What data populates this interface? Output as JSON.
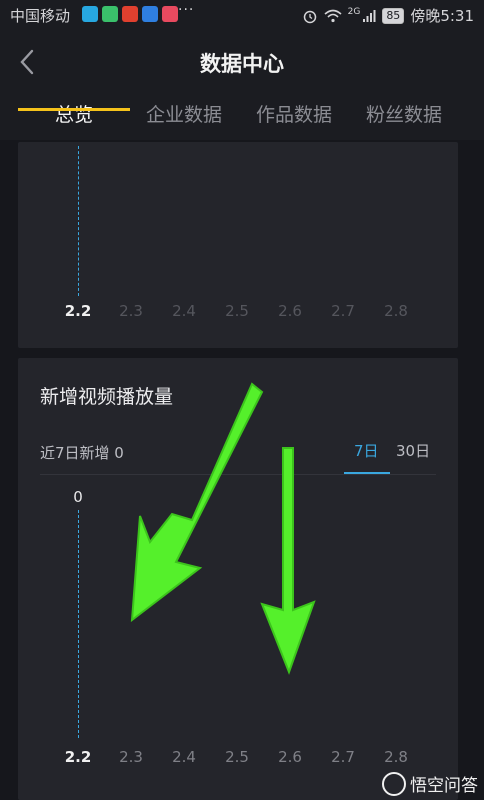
{
  "status_bar": {
    "carrier": "中国移动",
    "more": "···",
    "network": "2G",
    "battery": "85",
    "time": "傍晚5:31"
  },
  "header": {
    "title": "数据中心",
    "tabs": [
      "总览",
      "企业数据",
      "作品数据",
      "粉丝数据"
    ],
    "active_tab": "总览"
  },
  "top_chart": {
    "x_ticks": [
      "2.2",
      "2.3",
      "2.4",
      "2.5",
      "2.6",
      "2.7",
      "2.8"
    ]
  },
  "video_plays_card": {
    "title": "新增视频播放量",
    "summary": "近7日新增 0",
    "range_tabs": [
      "7日",
      "30日"
    ],
    "active_range": "7日",
    "y_value": "0",
    "x_ticks": [
      "2.2",
      "2.3",
      "2.4",
      "2.5",
      "2.6",
      "2.7",
      "2.8"
    ]
  },
  "watermark": {
    "text": "悟空问答"
  },
  "colors": {
    "accent_tab": "#f5c21b",
    "accent_blue": "#3aa7df",
    "annotation_arrow": "#55f02b"
  }
}
